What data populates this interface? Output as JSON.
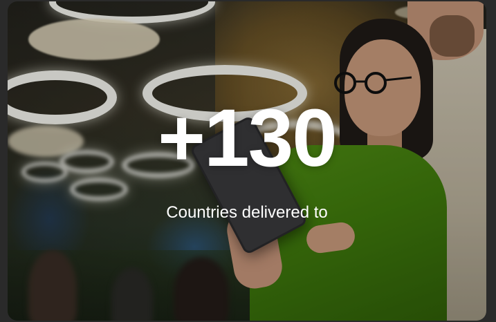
{
  "stat": {
    "value": "+130",
    "label": "Countries delivered to"
  },
  "image": {
    "subject": "woman-with-glasses-holding-tablet-icon"
  },
  "colors": {
    "text": "#ffffff",
    "shirt": "#3f7a0c"
  }
}
